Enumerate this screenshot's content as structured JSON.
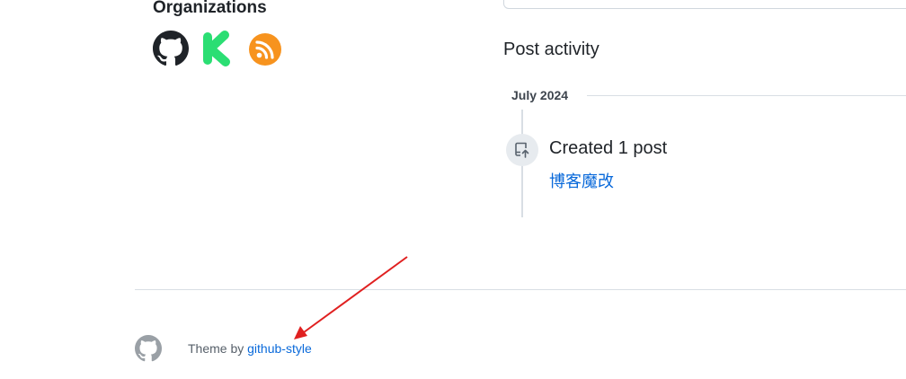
{
  "organizations": {
    "heading": "Organizations",
    "items": [
      {
        "name": "github-org",
        "icon": "github-icon",
        "color": "#1f2328"
      },
      {
        "name": "kickstarter-org",
        "icon": "kickstarter-icon",
        "color": "#2bde73"
      },
      {
        "name": "rss-org",
        "icon": "rss-icon",
        "color": "#f7931e"
      }
    ]
  },
  "activity": {
    "heading": "Post activity",
    "month": "July 2024",
    "events": [
      {
        "title": "Created 1 post",
        "link_text": "博客魔改",
        "icon": "repo-push-icon"
      }
    ]
  },
  "footer": {
    "text_prefix": "Theme by ",
    "theme_link": "github-style",
    "logo_icon": "github-icon"
  },
  "annotation": {
    "icon": "red-arrow-icon",
    "color": "#e02020"
  },
  "colors": {
    "link": "#0969da",
    "border": "#d8dee4",
    "text": "#1f2328",
    "muted": "#57606a"
  }
}
